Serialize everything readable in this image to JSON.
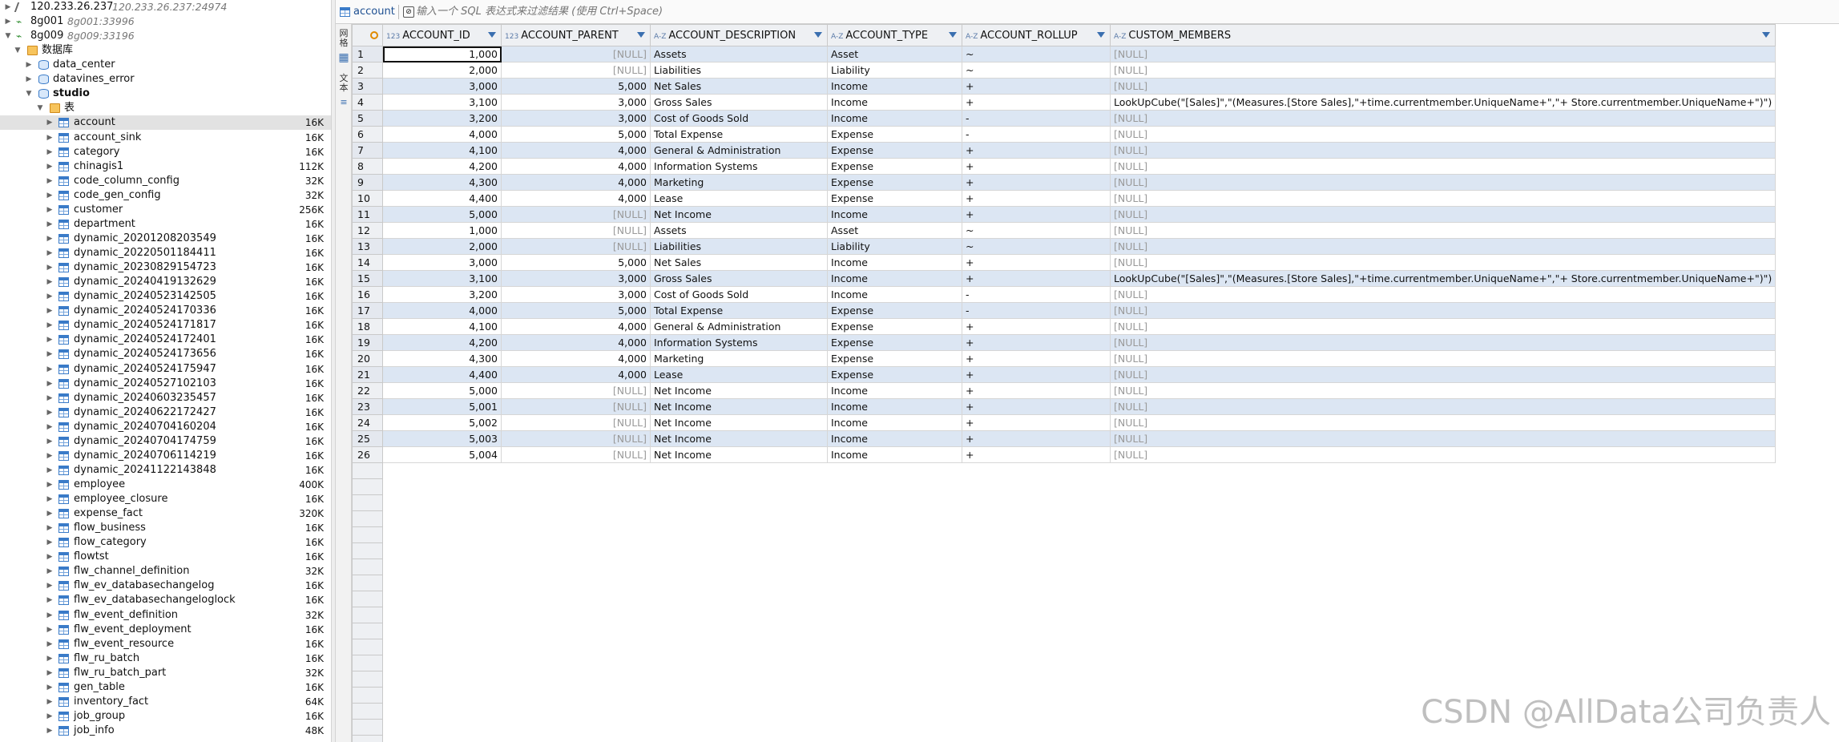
{
  "navigator": {
    "connections": [
      {
        "label": "120.233.26.237",
        "hint": "120.233.26.237:24974"
      },
      {
        "label": "8g001",
        "hint": "8g001:33996"
      },
      {
        "label": "8g009",
        "hint": "8g009:33196"
      }
    ],
    "db_folder": "数据库",
    "databases": [
      "data_center",
      "datavines_error",
      "studio"
    ],
    "tables_folder": "表",
    "tables": [
      {
        "name": "account",
        "size": "16K"
      },
      {
        "name": "account_sink",
        "size": "16K"
      },
      {
        "name": "category",
        "size": "16K"
      },
      {
        "name": "chinagis1",
        "size": "112K"
      },
      {
        "name": "code_column_config",
        "size": "32K"
      },
      {
        "name": "code_gen_config",
        "size": "32K"
      },
      {
        "name": "customer",
        "size": "256K"
      },
      {
        "name": "department",
        "size": "16K"
      },
      {
        "name": "dynamic_20201208203549",
        "size": "16K"
      },
      {
        "name": "dynamic_20220501184411",
        "size": "16K"
      },
      {
        "name": "dynamic_20230829154723",
        "size": "16K"
      },
      {
        "name": "dynamic_20240419132629",
        "size": "16K"
      },
      {
        "name": "dynamic_20240523142505",
        "size": "16K"
      },
      {
        "name": "dynamic_20240524170336",
        "size": "16K"
      },
      {
        "name": "dynamic_20240524171817",
        "size": "16K"
      },
      {
        "name": "dynamic_20240524172401",
        "size": "16K"
      },
      {
        "name": "dynamic_20240524173656",
        "size": "16K"
      },
      {
        "name": "dynamic_20240524175947",
        "size": "16K"
      },
      {
        "name": "dynamic_20240527102103",
        "size": "16K"
      },
      {
        "name": "dynamic_20240603235457",
        "size": "16K"
      },
      {
        "name": "dynamic_20240622172427",
        "size": "16K"
      },
      {
        "name": "dynamic_20240704160204",
        "size": "16K"
      },
      {
        "name": "dynamic_20240704174759",
        "size": "16K"
      },
      {
        "name": "dynamic_20240706114219",
        "size": "16K"
      },
      {
        "name": "dynamic_20241122143848",
        "size": "16K"
      },
      {
        "name": "employee",
        "size": "400K"
      },
      {
        "name": "employee_closure",
        "size": "16K"
      },
      {
        "name": "expense_fact",
        "size": "320K"
      },
      {
        "name": "flow_business",
        "size": "16K"
      },
      {
        "name": "flow_category",
        "size": "16K"
      },
      {
        "name": "flowtst",
        "size": "16K"
      },
      {
        "name": "flw_channel_definition",
        "size": "32K"
      },
      {
        "name": "flw_ev_databasechangelog",
        "size": "16K"
      },
      {
        "name": "flw_ev_databasechangeloglock",
        "size": "16K"
      },
      {
        "name": "flw_event_definition",
        "size": "32K"
      },
      {
        "name": "flw_event_deployment",
        "size": "16K"
      },
      {
        "name": "flw_event_resource",
        "size": "16K"
      },
      {
        "name": "flw_ru_batch",
        "size": "16K"
      },
      {
        "name": "flw_ru_batch_part",
        "size": "32K"
      },
      {
        "name": "gen_table",
        "size": "16K"
      },
      {
        "name": "inventory_fact",
        "size": "64K"
      },
      {
        "name": "job_group",
        "size": "16K"
      },
      {
        "name": "job_info",
        "size": "48K"
      }
    ]
  },
  "editor": {
    "tab_label": "account",
    "filter_placeholder": "输入一个 SQL 表达式来过滤结果 (使用 Ctrl+Space)",
    "side_tabs": [
      "网格",
      "文本"
    ],
    "columns": [
      {
        "type": "123",
        "name": "ACCOUNT_ID"
      },
      {
        "type": "123",
        "name": "ACCOUNT_PARENT"
      },
      {
        "type": "A-Z",
        "name": "ACCOUNT_DESCRIPTION"
      },
      {
        "type": "A-Z",
        "name": "ACCOUNT_TYPE"
      },
      {
        "type": "A-Z",
        "name": "ACCOUNT_ROLLUP"
      },
      {
        "type": "A-Z",
        "name": "CUSTOM_MEMBERS"
      }
    ],
    "null_text": "[NULL]",
    "rows": [
      [
        "1",
        "1,000",
        "[NULL]",
        "Assets",
        "Asset",
        "~",
        "[NULL]"
      ],
      [
        "2",
        "2,000",
        "[NULL]",
        "Liabilities",
        "Liability",
        "~",
        "[NULL]"
      ],
      [
        "3",
        "3,000",
        "5,000",
        "Net Sales",
        "Income",
        "+",
        "[NULL]"
      ],
      [
        "4",
        "3,100",
        "3,000",
        "Gross Sales",
        "Income",
        "+",
        "LookUpCube(\"[Sales]\",\"(Measures.[Store Sales],\"+time.currentmember.UniqueName+\",\"+ Store.currentmember.UniqueName+\")\")"
      ],
      [
        "5",
        "3,200",
        "3,000",
        "Cost of Goods Sold",
        "Income",
        "-",
        "[NULL]"
      ],
      [
        "6",
        "4,000",
        "5,000",
        "Total Expense",
        "Expense",
        "-",
        "[NULL]"
      ],
      [
        "7",
        "4,100",
        "4,000",
        "General & Administration",
        "Expense",
        "+",
        "[NULL]"
      ],
      [
        "8",
        "4,200",
        "4,000",
        "Information Systems",
        "Expense",
        "+",
        "[NULL]"
      ],
      [
        "9",
        "4,300",
        "4,000",
        "Marketing",
        "Expense",
        "+",
        "[NULL]"
      ],
      [
        "10",
        "4,400",
        "4,000",
        "Lease",
        "Expense",
        "+",
        "[NULL]"
      ],
      [
        "11",
        "5,000",
        "[NULL]",
        "Net Income",
        "Income",
        "+",
        "[NULL]"
      ],
      [
        "12",
        "1,000",
        "[NULL]",
        "Assets",
        "Asset",
        "~",
        "[NULL]"
      ],
      [
        "13",
        "2,000",
        "[NULL]",
        "Liabilities",
        "Liability",
        "~",
        "[NULL]"
      ],
      [
        "14",
        "3,000",
        "5,000",
        "Net Sales",
        "Income",
        "+",
        "[NULL]"
      ],
      [
        "15",
        "3,100",
        "3,000",
        "Gross Sales",
        "Income",
        "+",
        "LookUpCube(\"[Sales]\",\"(Measures.[Store Sales],\"+time.currentmember.UniqueName+\",\"+ Store.currentmember.UniqueName+\")\")"
      ],
      [
        "16",
        "3,200",
        "3,000",
        "Cost of Goods Sold",
        "Income",
        "-",
        "[NULL]"
      ],
      [
        "17",
        "4,000",
        "5,000",
        "Total Expense",
        "Expense",
        "-",
        "[NULL]"
      ],
      [
        "18",
        "4,100",
        "4,000",
        "General & Administration",
        "Expense",
        "+",
        "[NULL]"
      ],
      [
        "19",
        "4,200",
        "4,000",
        "Information Systems",
        "Expense",
        "+",
        "[NULL]"
      ],
      [
        "20",
        "4,300",
        "4,000",
        "Marketing",
        "Expense",
        "+",
        "[NULL]"
      ],
      [
        "21",
        "4,400",
        "4,000",
        "Lease",
        "Expense",
        "+",
        "[NULL]"
      ],
      [
        "22",
        "5,000",
        "[NULL]",
        "Net Income",
        "Income",
        "+",
        "[NULL]"
      ],
      [
        "23",
        "5,001",
        "[NULL]",
        "Net Income",
        "Income",
        "+",
        "[NULL]"
      ],
      [
        "24",
        "5,002",
        "[NULL]",
        "Net Income",
        "Income",
        "+",
        "[NULL]"
      ],
      [
        "25",
        "5,003",
        "[NULL]",
        "Net Income",
        "Income",
        "+",
        "[NULL]"
      ],
      [
        "26",
        "5,004",
        "[NULL]",
        "Net Income",
        "Income",
        "+",
        "[NULL]"
      ]
    ]
  },
  "watermark": "CSDN @AllData公司负责人"
}
